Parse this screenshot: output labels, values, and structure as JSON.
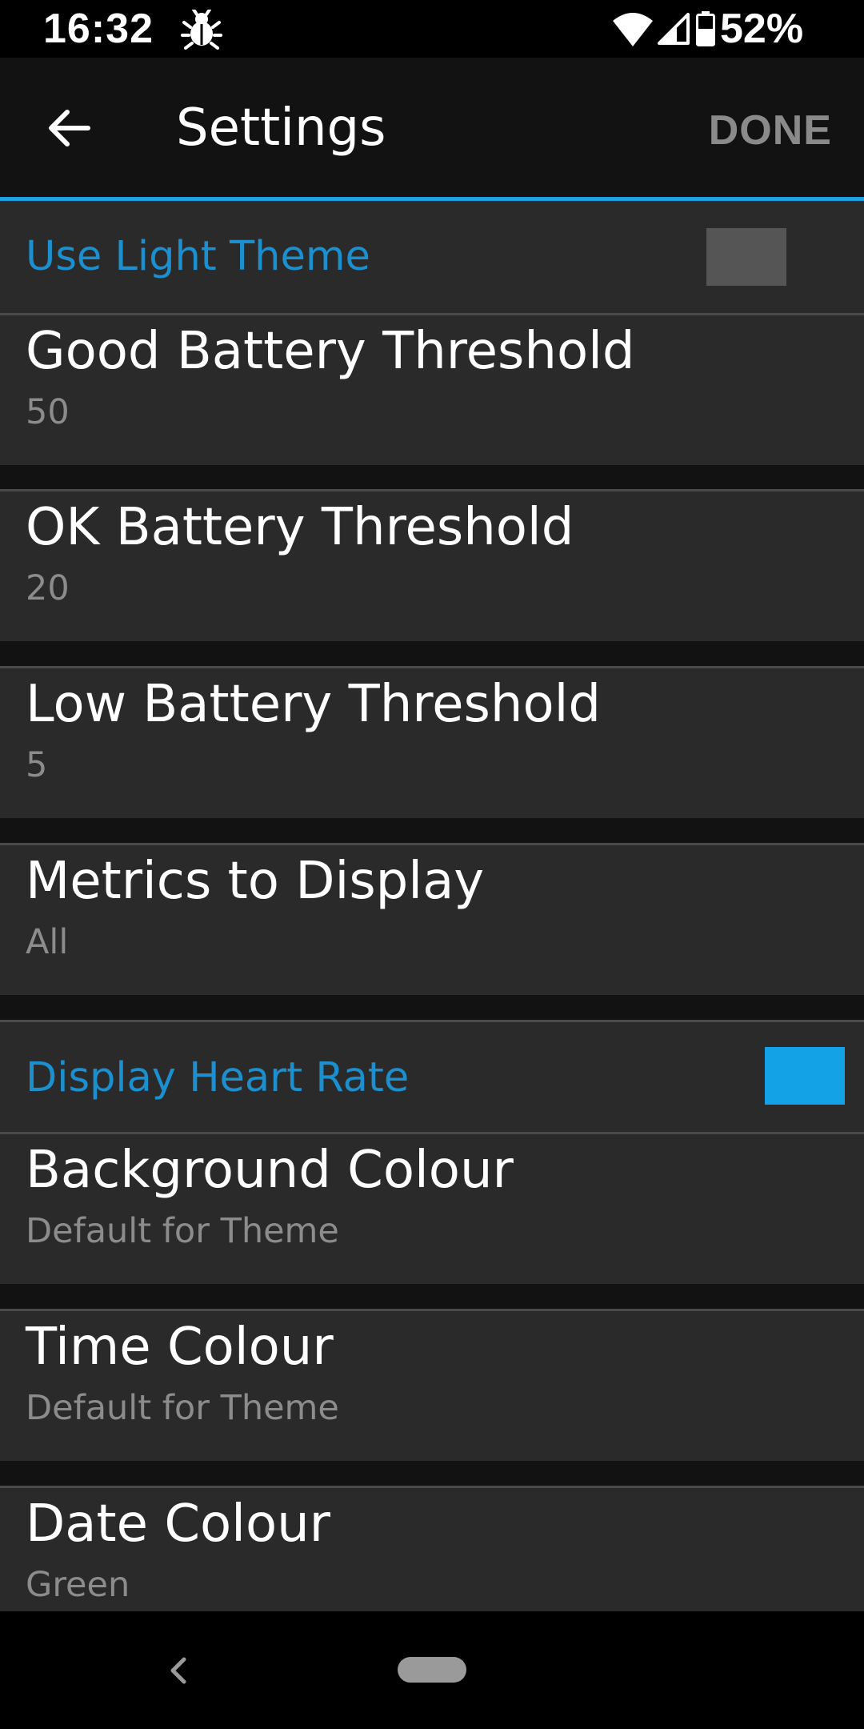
{
  "status_bar": {
    "time": "16:32",
    "notification_icon": "bug-icon",
    "battery_percent": "52%",
    "icons": [
      "wifi-icon",
      "signal-icon",
      "battery-icon"
    ]
  },
  "app_bar": {
    "title": "Settings",
    "done_label": "DONE",
    "back_icon": "arrow-left-icon",
    "accent_color": "#1ea0e0"
  },
  "settings": {
    "use_light_theme": {
      "label": "Use Light Theme",
      "enabled": false,
      "color": "#555555"
    },
    "good_battery": {
      "title": "Good Battery Threshold",
      "value": "50"
    },
    "ok_battery": {
      "title": "OK Battery Threshold",
      "value": "20"
    },
    "low_battery": {
      "title": "Low Battery Threshold",
      "value": "5"
    },
    "metrics": {
      "title": "Metrics to Display",
      "value": "All"
    },
    "display_heart_rate": {
      "label": "Display Heart Rate",
      "enabled": true,
      "color": "#13a2e6"
    },
    "background_colour": {
      "title": "Background Colour",
      "value": "Default for Theme"
    },
    "time_colour": {
      "title": "Time Colour",
      "value": "Default for Theme"
    },
    "date_colour": {
      "title": "Date Colour",
      "value": "Green"
    }
  },
  "nav_bar": {
    "back_icon": "chevron-left-icon",
    "home_icon": "home-pill-icon"
  }
}
